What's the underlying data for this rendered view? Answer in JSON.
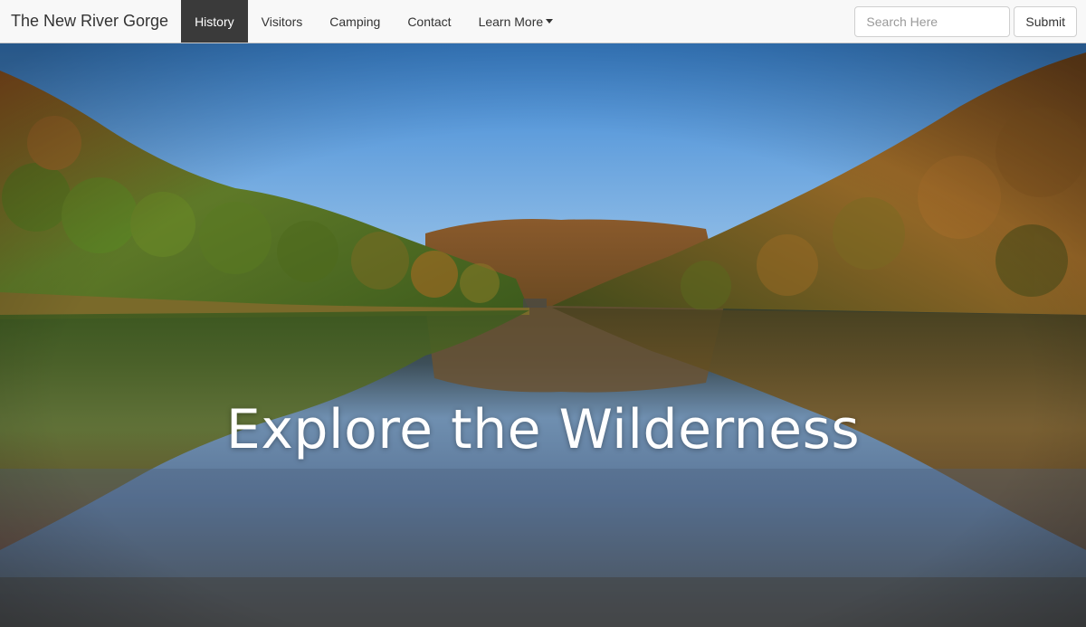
{
  "navbar": {
    "brand": "The New River Gorge",
    "items": [
      {
        "label": "History",
        "active": true
      },
      {
        "label": "Visitors",
        "active": false
      },
      {
        "label": "Camping",
        "active": false
      },
      {
        "label": "Contact",
        "active": false
      },
      {
        "label": "Learn More",
        "active": false,
        "dropdown": true
      }
    ],
    "search": {
      "placeholder": "Search Here",
      "value": ""
    },
    "submit_label": "Submit"
  },
  "hero": {
    "headline": "Explore the Wilderness",
    "image_icon": "river-gorge-landscape"
  },
  "colors": {
    "navbar_bg": "#f8f8f8",
    "active_tab_bg": "#3a3a3a",
    "headline": "#ffffff",
    "sky": "#4f96d8"
  }
}
